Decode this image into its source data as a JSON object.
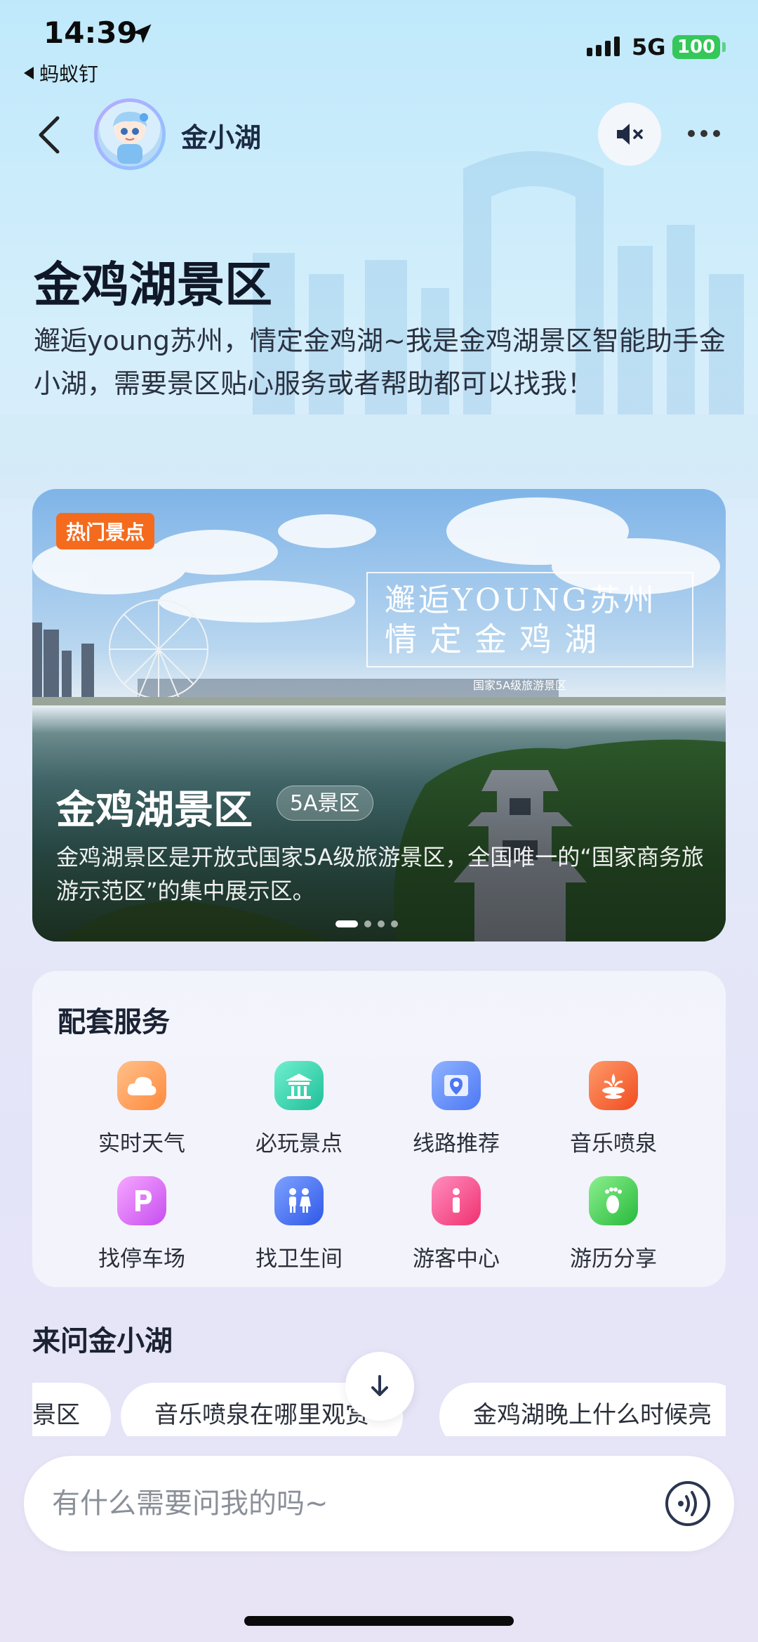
{
  "status_bar": {
    "time": "14:39",
    "back_app": "蚂蚁钉",
    "network": "5G",
    "battery": "100"
  },
  "nav": {
    "assistant_name": "金小湖",
    "back_icon": "chevron-left-icon",
    "mute_icon": "speaker-muted-icon",
    "more_icon": "more-dots-icon"
  },
  "header": {
    "title": "金鸡湖景区",
    "intro": "邂逅young苏州，情定金鸡湖~我是金鸡湖景区智能助手金小湖，需要景区贴心服务或者帮助都可以找我！"
  },
  "hero": {
    "tag": "热门景点",
    "slogan_line1": "邂逅YOUNG苏州",
    "slogan_line2": "情定金鸡湖",
    "slogan_small": "国家5A级旅游景区",
    "title": "金鸡湖景区",
    "badge": "5A景区",
    "description": "金鸡湖景区是开放式国家5A级旅游景区，全国唯一的“国家商务旅游示范区”的集中展示区。",
    "slide_count": 4,
    "active_slide": 1
  },
  "services": {
    "title": "配套服务",
    "items": [
      {
        "label": "实时天气",
        "icon": "weather-cloud-icon",
        "color": "#ff9a4d"
      },
      {
        "label": "必玩景点",
        "icon": "pavilion-icon",
        "color": "#2fd2b0"
      },
      {
        "label": "线路推荐",
        "icon": "map-pin-icon",
        "color": "#5b8cff"
      },
      {
        "label": "音乐喷泉",
        "icon": "fountain-icon",
        "color": "#ff6b3d"
      },
      {
        "label": "找停车场",
        "icon": "parking-icon",
        "color": "#e46cf2"
      },
      {
        "label": "找卫生间",
        "icon": "restroom-icon",
        "color": "#3d6dff"
      },
      {
        "label": "游客中心",
        "icon": "info-icon",
        "color": "#ff3d8a"
      },
      {
        "label": "游历分享",
        "icon": "footprint-icon",
        "color": "#3ccf4a"
      }
    ]
  },
  "ask": {
    "title": "来问金小湖",
    "chips": [
      "景区",
      "音乐喷泉在哪里观赏",
      "金鸡湖晚上什么时候亮"
    ]
  },
  "input": {
    "placeholder": "有什么需要问我的吗~",
    "voice_icon": "voice-wave-icon"
  }
}
